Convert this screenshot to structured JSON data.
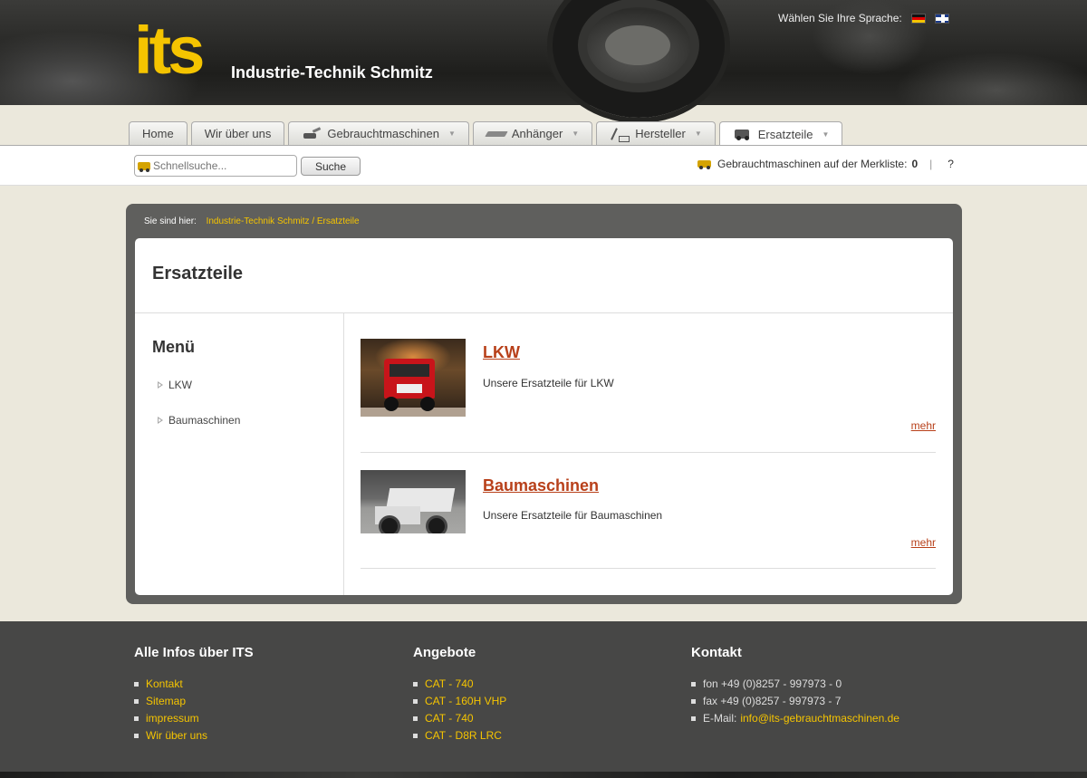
{
  "header": {
    "logo_text": "its",
    "company_name": "Industrie-Technik Schmitz",
    "language_prompt": "Wählen Sie Ihre Sprache:"
  },
  "nav": {
    "tabs": [
      {
        "label": "Home",
        "icon": "",
        "dropdown": false
      },
      {
        "label": "Wir über uns",
        "icon": "",
        "dropdown": false
      },
      {
        "label": "Gebrauchtmaschinen",
        "icon": "excavator-icon",
        "dropdown": true
      },
      {
        "label": "Anhänger",
        "icon": "trailer-icon",
        "dropdown": true
      },
      {
        "label": "Hersteller",
        "icon": "crane-icon",
        "dropdown": true
      },
      {
        "label": "Ersatzteile",
        "icon": "loader-icon",
        "dropdown": true,
        "active": true
      }
    ]
  },
  "search": {
    "placeholder": "Schnellsuche...",
    "button_label": "Suche"
  },
  "merkliste": {
    "label": "Gebrauchtmaschinen auf der Merkliste:",
    "count": "0",
    "help": "?"
  },
  "breadcrumb": {
    "prefix": "Sie sind hier:",
    "items": [
      "Industrie-Technik Schmitz",
      "/",
      "Ersatzteile"
    ]
  },
  "page": {
    "title": "Ersatzteile",
    "menu_title": "Menü",
    "menu_items": [
      "LKW",
      "Baumaschinen"
    ]
  },
  "entries": [
    {
      "title": "LKW",
      "description": "Unsere Ersatzteile für LKW",
      "more": "mehr"
    },
    {
      "title": "Baumaschinen",
      "description": "Unsere Ersatzteile für Baumaschinen",
      "more": "mehr"
    }
  ],
  "footer": {
    "col1": {
      "title": "Alle Infos über ITS",
      "items": [
        "Kontakt",
        "Sitemap",
        "impressum",
        "Wir über uns"
      ]
    },
    "col2": {
      "title": "Angebote",
      "items": [
        "CAT - 740",
        "CAT - 160H VHP",
        "CAT - 740",
        "CAT - D8R LRC"
      ]
    },
    "col3": {
      "title": "Kontakt",
      "phone": "fon +49 (0)8257 - 997973 - 0",
      "fax": "fax +49 (0)8257 - 997973 - 7",
      "email_label": "E-Mail:",
      "email": "info@its-gebrauchtmaschinen.de"
    }
  },
  "colors": {
    "brand_yellow": "#f5c400",
    "link_red": "#b8401a",
    "frame_gray": "#5f5f5d",
    "footer_gray": "#474746"
  }
}
